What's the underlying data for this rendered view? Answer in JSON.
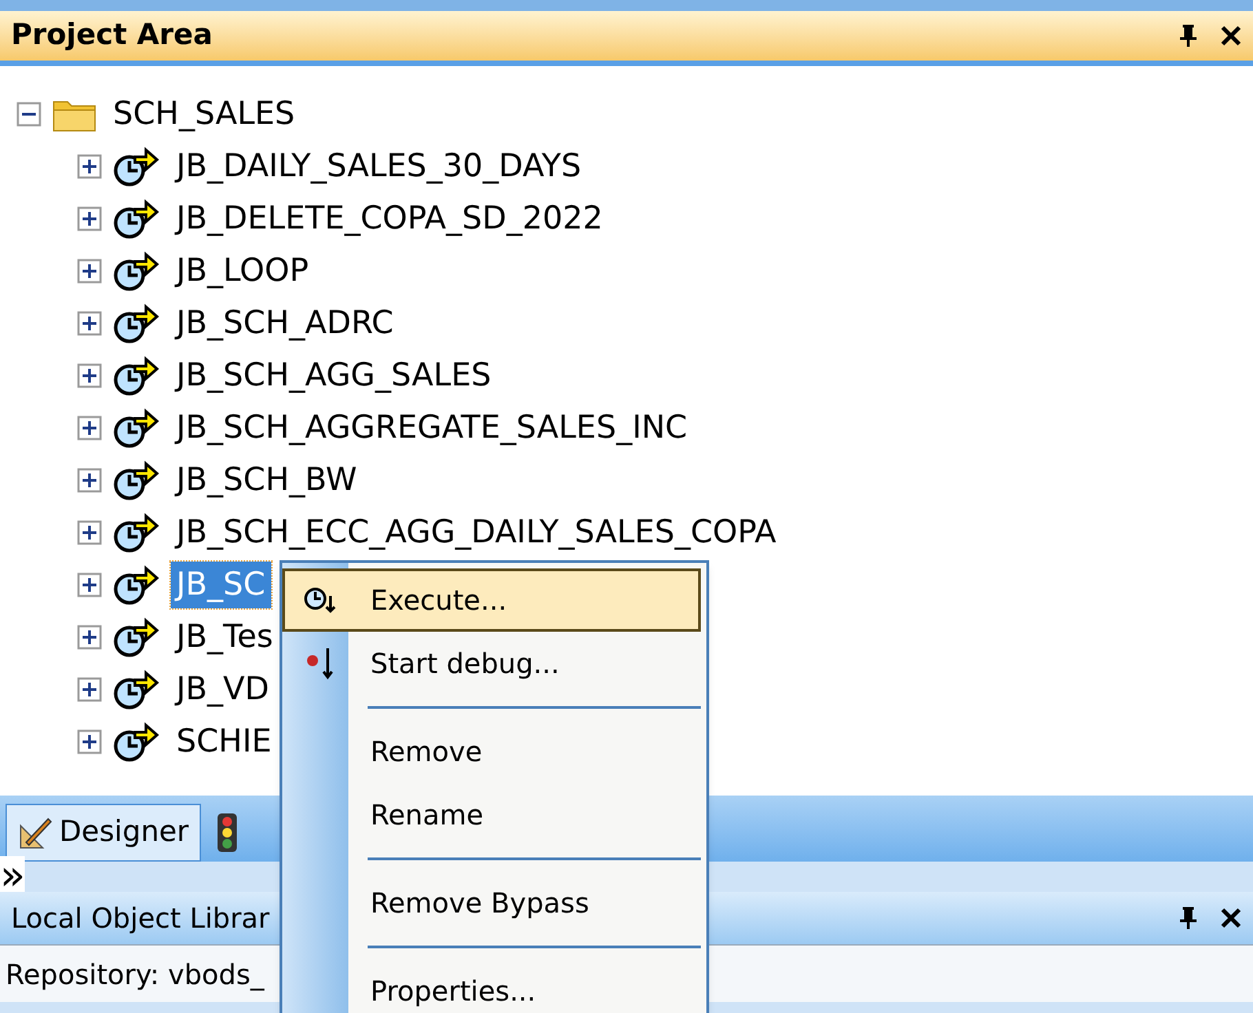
{
  "project_area": {
    "title": "Project Area",
    "tree": [
      {
        "label": "SCH_SALES",
        "kind": "folder",
        "expanded": true,
        "selected": false,
        "children": [
          {
            "label": "JB_DAILY_SALES_30_DAYS",
            "kind": "job",
            "expanded": false,
            "selected": false
          },
          {
            "label": "JB_DELETE_COPA_SD_2022",
            "kind": "job",
            "expanded": false,
            "selected": false
          },
          {
            "label": "JB_LOOP",
            "kind": "job",
            "expanded": false,
            "selected": false
          },
          {
            "label": "JB_SCH_ADRC",
            "kind": "job",
            "expanded": false,
            "selected": false
          },
          {
            "label": "JB_SCH_AGG_SALES",
            "kind": "job",
            "expanded": false,
            "selected": false
          },
          {
            "label": "JB_SCH_AGGREGATE_SALES_INC",
            "kind": "job",
            "expanded": false,
            "selected": false
          },
          {
            "label": "JB_SCH_BW",
            "kind": "job",
            "expanded": false,
            "selected": false
          },
          {
            "label": "JB_SCH_ECC_AGG_DAILY_SALES_COPA",
            "kind": "job",
            "expanded": false,
            "selected": false
          },
          {
            "label": "JB_SC",
            "kind": "job",
            "expanded": false,
            "selected": true
          },
          {
            "label": "JB_Tes",
            "kind": "job",
            "expanded": false,
            "selected": false
          },
          {
            "label": "JB_VD",
            "kind": "job",
            "expanded": false,
            "selected": false
          },
          {
            "label": "SCHIE",
            "kind": "job",
            "expanded": false,
            "selected": false
          }
        ]
      }
    ]
  },
  "tabs": [
    {
      "label": "Designer",
      "kind": "designer",
      "selected": true
    },
    {
      "kind": "monitor",
      "selected": false
    }
  ],
  "overflow": "»",
  "library": {
    "title": "Local Object Librar",
    "repository": "Repository: vbods_"
  },
  "context_menu": [
    {
      "kind": "execute",
      "label": "Execute...",
      "selected": true
    },
    {
      "kind": "debug",
      "label": "Start debug...",
      "selected": false
    },
    {
      "kind": "separator"
    },
    {
      "kind": "item",
      "label": "Remove",
      "selected": false
    },
    {
      "kind": "item",
      "label": "Rename",
      "selected": false
    },
    {
      "kind": "separator"
    },
    {
      "kind": "item",
      "label": "Remove Bypass",
      "selected": false
    },
    {
      "kind": "separator"
    },
    {
      "kind": "item",
      "label": "Properties...",
      "selected": false
    }
  ]
}
